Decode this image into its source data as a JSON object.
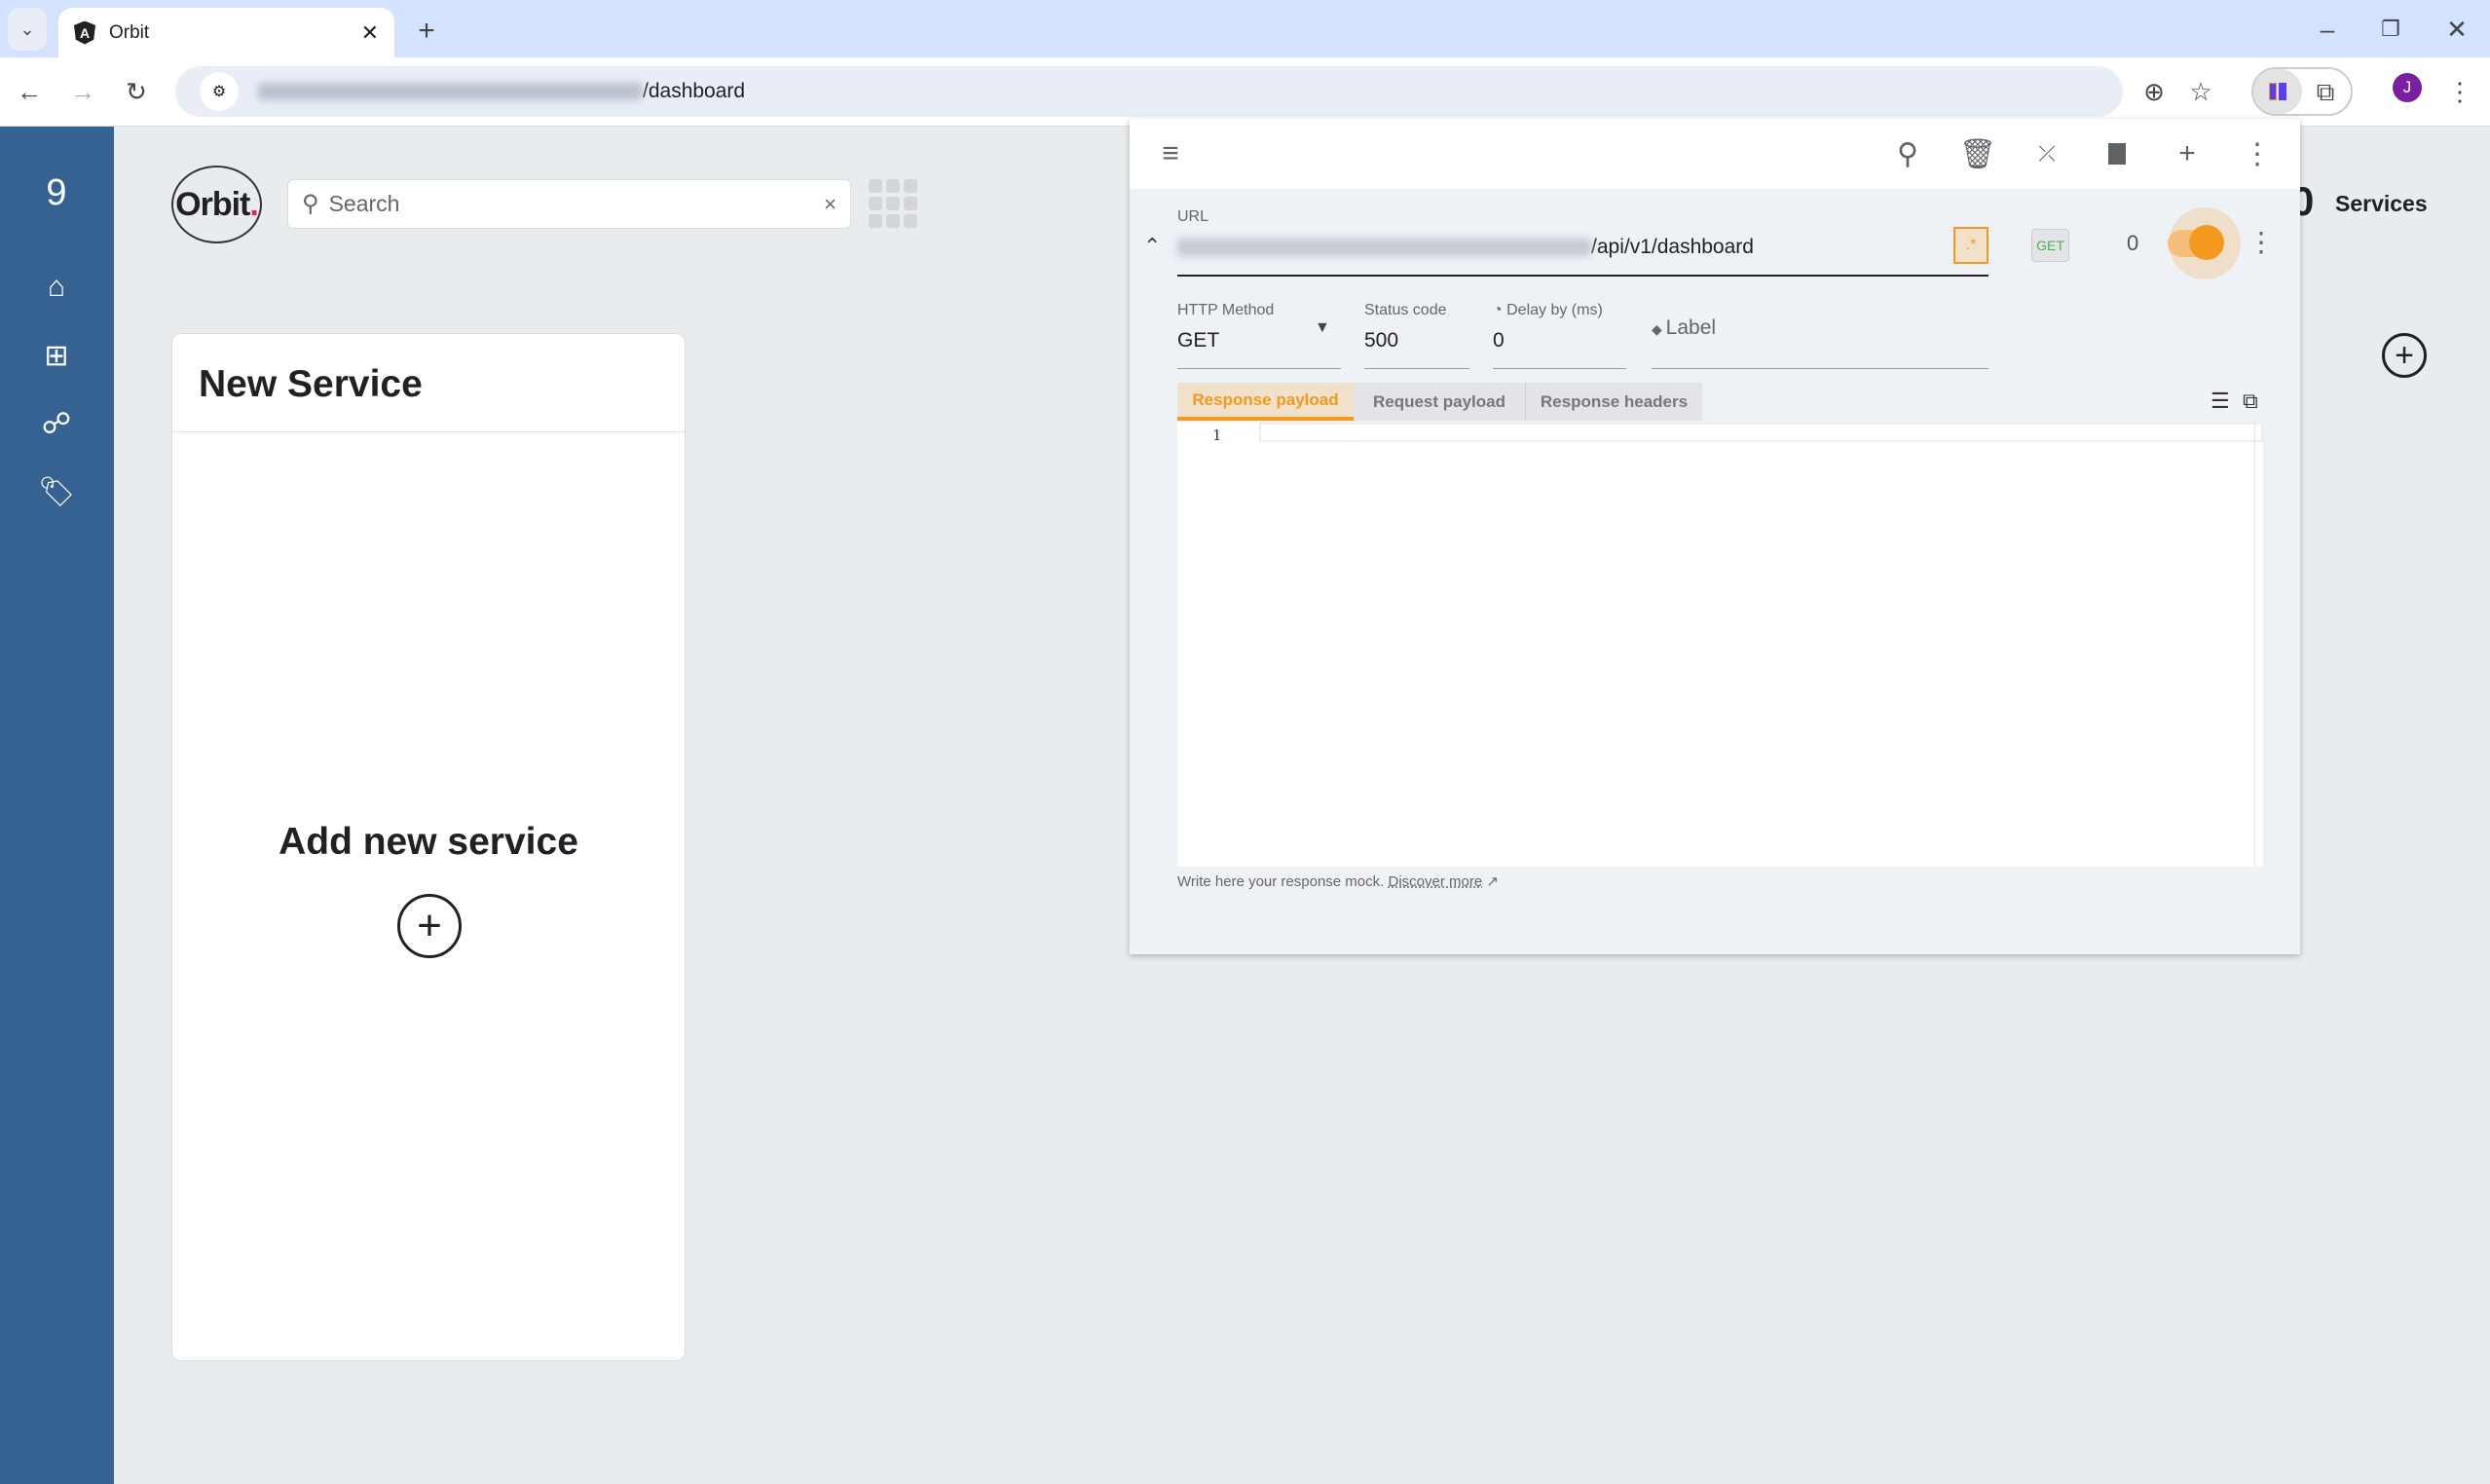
{
  "browser": {
    "tab_title": "Orbit",
    "url_visible": "/dashboard",
    "profile_initial": "J",
    "icons": [
      "angular-icon",
      "close-icon",
      "new-tab-icon",
      "back-icon",
      "forward-icon",
      "reload-icon",
      "site-settings-icon",
      "zoom-icon",
      "star-icon",
      "extension-icon",
      "puzzle-icon",
      "more-icon",
      "minimize-icon",
      "restore-icon",
      "window-close-icon"
    ]
  },
  "sidebar": {
    "items": [
      {
        "icon": "home-icon"
      },
      {
        "icon": "signpost-icon"
      },
      {
        "icon": "sitemap-icon"
      },
      {
        "icon": "tags-icon"
      }
    ]
  },
  "header": {
    "logo": "Orbit",
    "search_placeholder": "Search",
    "clear": "×"
  },
  "card": {
    "title": "New Service",
    "add_label": "Add new service"
  },
  "services": {
    "count": "0",
    "label": "Services"
  },
  "panel": {
    "url_label": "URL",
    "url_visible": "/api/v1/dashboard",
    "regex": ".*",
    "method_badge": "GET",
    "hit_count": "0",
    "enabled": true,
    "http_method_label": "HTTP Method",
    "http_method": "GET",
    "status_label": "Status code",
    "status": "500",
    "delay_label": "Delay by (ms)",
    "delay": "0",
    "label_placeholder": "Label",
    "tabs": [
      {
        "label": "Response payload",
        "active": true
      },
      {
        "label": "Request payload"
      },
      {
        "label": "Response headers"
      }
    ],
    "line_number": "1",
    "hint": "Write here your response mock.",
    "hint_link": "Discover more"
  },
  "colors": {
    "sidebar": "#366291",
    "accent": "#f39a1e",
    "page_bg": "#e9ecef"
  }
}
